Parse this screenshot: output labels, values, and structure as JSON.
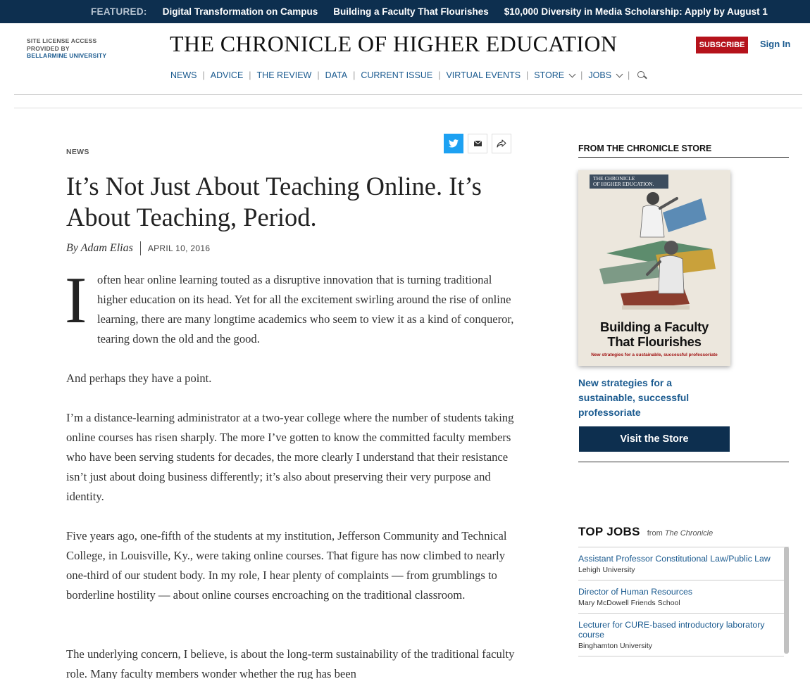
{
  "featured": {
    "label": "FEATURED:",
    "links": [
      "Digital Transformation on Campus",
      "Building a Faculty That Flourishes",
      "$10,000 Diversity in Media Scholarship: Apply by August 1"
    ]
  },
  "header": {
    "license_line1": "SITE LICENSE ACCESS",
    "license_line2": "PROVIDED BY",
    "license_university": "BELLARMINE UNIVERSITY",
    "masthead": "THE CHRONICLE OF HIGHER EDUCATION",
    "subscribe": "SUBSCRIBE",
    "sign_in": "Sign In"
  },
  "nav": {
    "items": [
      "NEWS",
      "ADVICE",
      "THE REVIEW",
      "DATA",
      "CURRENT ISSUE",
      "VIRTUAL EVENTS",
      "STORE",
      "JOBS"
    ],
    "icons": {
      "store_dropdown": "chevron-down-icon",
      "jobs_dropdown": "chevron-down-icon",
      "search": "search-icon"
    }
  },
  "article": {
    "kicker": "NEWS",
    "headline": "It’s Not Just About Teaching Online. It’s About Teaching, Period.",
    "byline": "By Adam Elias",
    "date": "APRIL 10, 2016",
    "dropcap": "I",
    "paragraphs": [
      "often hear online learning touted as a disruptive innovation that is turning traditional higher education on its head. Yet for all the excitement swirling around the rise of online learning, there are many longtime academics who seem to view it as a kind of conqueror, tearing down the old and the good.",
      "And perhaps they have a point.",
      "I’m a distance-learning administrator at a two-year college where the number of students taking online courses has risen sharply. The more I’ve gotten to know the committed faculty members who have been serving students for decades, the more clearly I understand that their resistance isn’t just about doing business differently; it’s also about preserving their very purpose and identity.",
      "Five years ago, one-fifth of the students at my institution, Jefferson Community and Technical College, in Louisville, Ky., were taking online courses. That figure has now climbed to nearly one-third of our student body. In my role, I hear plenty of complaints — from grumblings to borderline hostility — about online courses encroaching on the traditional classroom.",
      "The underlying concern, I believe, is about the long-term sustainability of the traditional faculty role. Many faculty members wonder whether the rug has been"
    ],
    "share_icons": [
      "twitter-icon",
      "email-icon",
      "share-icon"
    ]
  },
  "store": {
    "title": "FROM THE CHRONICLE STORE",
    "book_brand_line1": "THE CHRONICLE",
    "book_brand_line2": "OF HIGHER EDUCATION.",
    "book_title_line1": "Building a Faculty",
    "book_title_line2": "That Flourishes",
    "book_subtitle": "New strategies for a sustainable, successful professoriate",
    "description": "New strategies for a sustainable, successful professoriate",
    "button": "Visit the Store"
  },
  "jobs": {
    "title": "TOP JOBS",
    "from": "from",
    "source": "The Chronicle",
    "items": [
      {
        "title": "Assistant Professor Constitutional Law/Public Law",
        "org": "Lehigh University"
      },
      {
        "title": "Director of Human Resources",
        "org": "Mary McDowell Friends School"
      },
      {
        "title": "Lecturer for CURE-based introductory laboratory course",
        "org": "Binghamton University"
      }
    ]
  },
  "colors": {
    "navy": "#0d2f4f",
    "link_blue": "#1a5a8f",
    "subscribe_red": "#b5121b",
    "twitter_blue": "#1da1f2"
  }
}
